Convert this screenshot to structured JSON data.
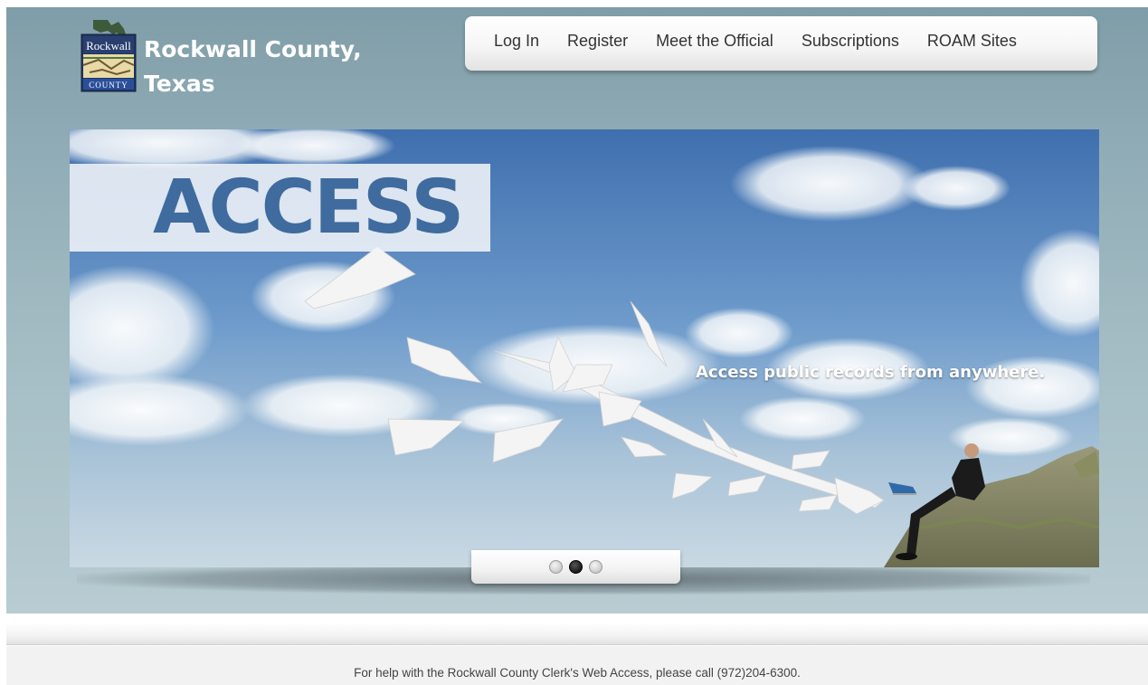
{
  "header": {
    "logo_text": "Rockwall",
    "logo_subtext": "COUNTY",
    "title_line1": "Rockwall County,",
    "title_line2": "Texas"
  },
  "nav": {
    "items": [
      {
        "label": "Log In"
      },
      {
        "label": "Register"
      },
      {
        "label": "Meet the Official"
      },
      {
        "label": "Subscriptions"
      },
      {
        "label": "ROAM Sites"
      }
    ]
  },
  "hero": {
    "headline": "ACCESS",
    "tagline": "Access public records from anywhere.",
    "slides": 3,
    "active_slide": 2
  },
  "footer": {
    "help_text": "For help with the Rockwall County Clerk's Web Access, please call (972)204-6300."
  },
  "colors": {
    "headline": "#3f6b9e",
    "sky_top": "#3f6fae",
    "sky_bottom": "#c4d6e2",
    "page_bg": "#8eaab4"
  }
}
